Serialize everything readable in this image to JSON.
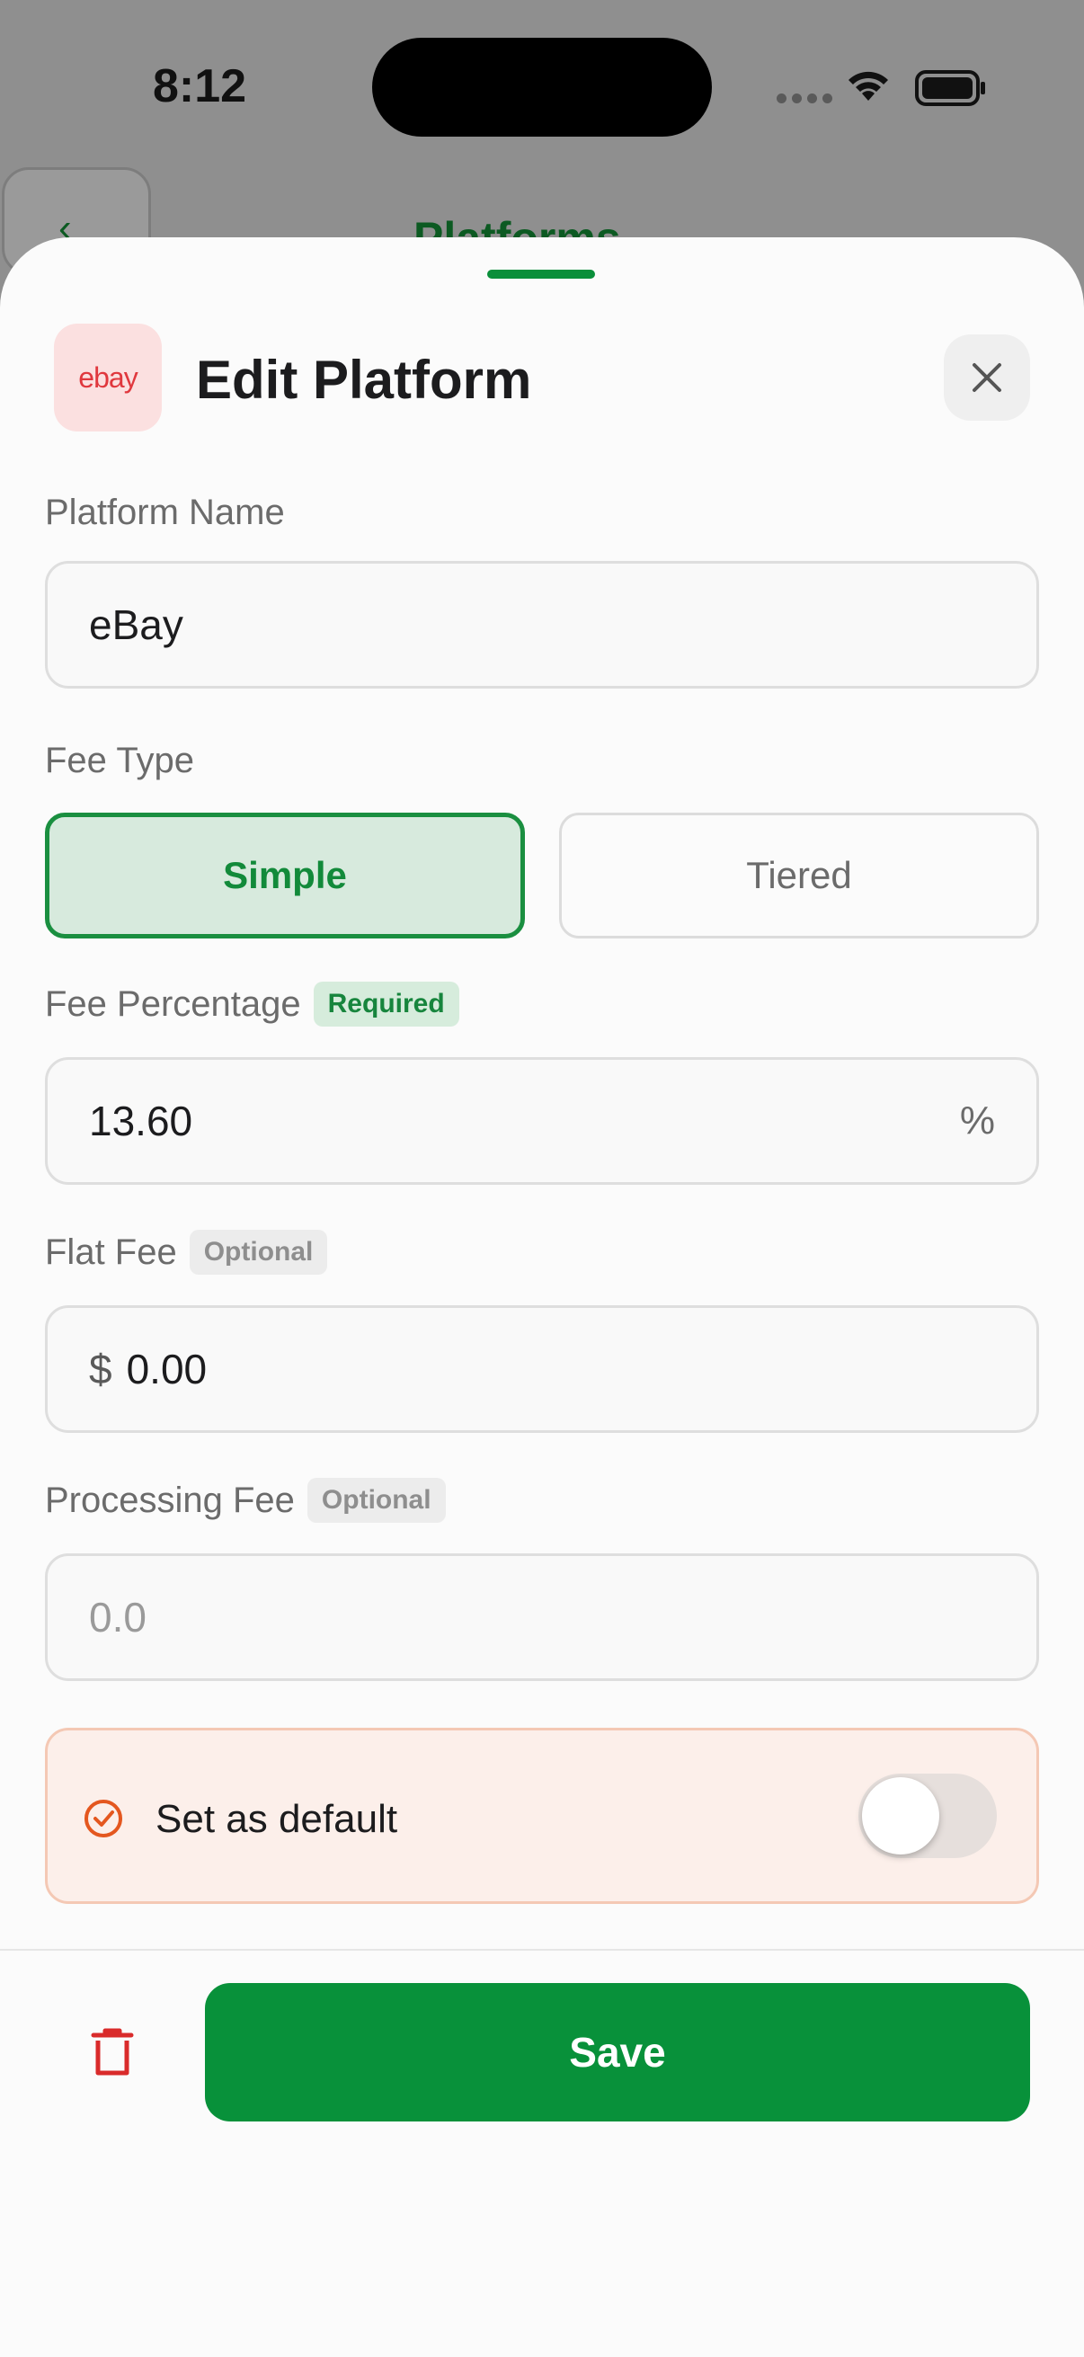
{
  "status_bar": {
    "time": "8:12"
  },
  "background": {
    "title": "Platforms"
  },
  "sheet": {
    "logo_text": "ebay",
    "title": "Edit Platform",
    "platform_name": {
      "label": "Platform Name",
      "value": "eBay"
    },
    "fee_type": {
      "label": "Fee Type",
      "options": [
        "Simple",
        "Tiered"
      ],
      "selected": "Simple"
    },
    "fee_percentage": {
      "label": "Fee Percentage",
      "badge": "Required",
      "value": "13.60",
      "suffix": "%"
    },
    "flat_fee": {
      "label": "Flat Fee",
      "badge": "Optional",
      "prefix": "$",
      "value": "0.00"
    },
    "processing_fee": {
      "label": "Processing Fee",
      "badge": "Optional",
      "placeholder": "0.0"
    },
    "default": {
      "label": "Set as default",
      "enabled": false
    },
    "save_label": "Save"
  },
  "colors": {
    "accent": "#08913a",
    "delete": "#d92b2b",
    "default_icon": "#e4571f"
  }
}
